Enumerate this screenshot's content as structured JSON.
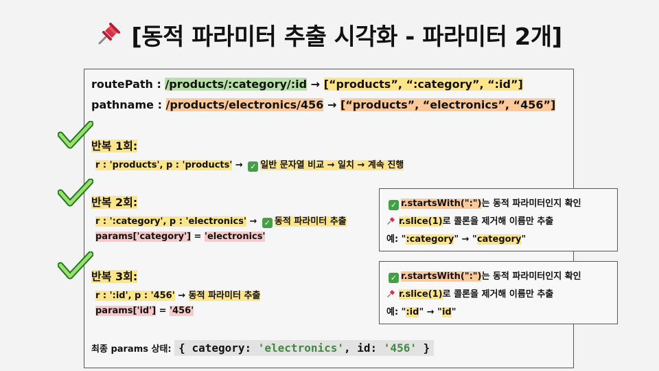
{
  "title": "[동적 파라미터 추출 시각화 - 파라미터 2개]",
  "colors": {
    "green": "#b8e0a8",
    "orange": "#fcc99a",
    "yellow": "#fde58a",
    "pink": "#f8c9c9",
    "check": "#43a047"
  },
  "icons": {
    "title": "pushpin-icon",
    "iteration": "checkmark-icon",
    "check": "check-box-icon"
  },
  "route": {
    "label": "routePath : ",
    "path": "/products/:category/:id",
    "arrow": " → ",
    "array": "[“products”, “:category”, “:id”]"
  },
  "pathname": {
    "label": "pathname  : ",
    "path": "/products/electronics/456",
    "arrow": " → ",
    "array": "[“products”, “electronics”, “456”]"
  },
  "iterations": [
    {
      "heading": "반복 1회:",
      "compare": "r : 'products', p : 'products'",
      "result_arrow": "  → ",
      "result": "일반 문자열 비교 → 일치 → 계속 진행"
    },
    {
      "heading": "반복 2회:",
      "compare": "r : ':category', p : 'electronics'",
      "result_arrow": " → ",
      "result": "동적 파라미터 추출",
      "assign_key": "params['category']",
      "assign_eq": " = ",
      "assign_value": "'electronics'"
    },
    {
      "heading": "반복 3회:",
      "compare": "r : ':id', p : '456'",
      "result_arrow": " → ",
      "result": "동적 파라미터 추출",
      "assign_key": "params['id']",
      "assign_eq": " = ",
      "assign_value": "'456'"
    }
  ],
  "final": {
    "label": "최종 params 상태: ",
    "open": "{ ",
    "k1": "category: ",
    "v1": "'electronics'",
    "sep": ", ",
    "k2": "id: ",
    "v2": "'456'",
    "close": " }"
  },
  "info_boxes": [
    {
      "line1_code": "r.startsWith(\":\")",
      "line1_text": "는 동적 파라미터인지 확인",
      "line2_code": "r.slice(1)",
      "line2_text": "로 콜론을 제거해 이름만 추출",
      "line3_prefix": "예: \"",
      "line3_from": ":category",
      "line3_mid": "\" → \"",
      "line3_to": "category",
      "line3_suffix": "\""
    },
    {
      "line1_code": "r.startsWith(\":\")",
      "line1_text": "는 동적 파라미터인지 확인",
      "line2_code": "r.slice(1)",
      "line2_text": "로 콜론을 제거해 이름만 추출",
      "line3_prefix": "예: \"",
      "line3_from": ":id",
      "line3_mid": "\" → \"",
      "line3_to": "id",
      "line3_suffix": "\""
    }
  ]
}
